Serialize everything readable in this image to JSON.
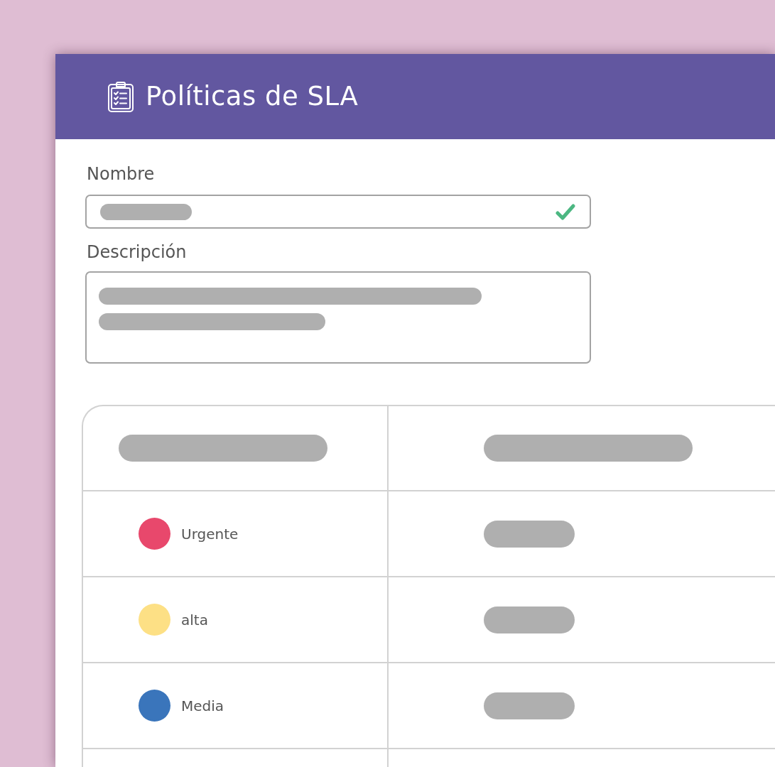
{
  "header": {
    "title": "Políticas de SLA"
  },
  "form": {
    "fields": [
      {
        "kind": "input",
        "label": "Nombre",
        "valid": true
      },
      {
        "kind": "textarea",
        "label": "Descripción",
        "valid": false
      }
    ]
  },
  "table": {
    "rows": [
      {
        "label": "Urgente",
        "color": "#e8486c"
      },
      {
        "label": "alta",
        "color": "#fde085"
      },
      {
        "label": "Media",
        "color": "#3a75bb"
      }
    ]
  }
}
